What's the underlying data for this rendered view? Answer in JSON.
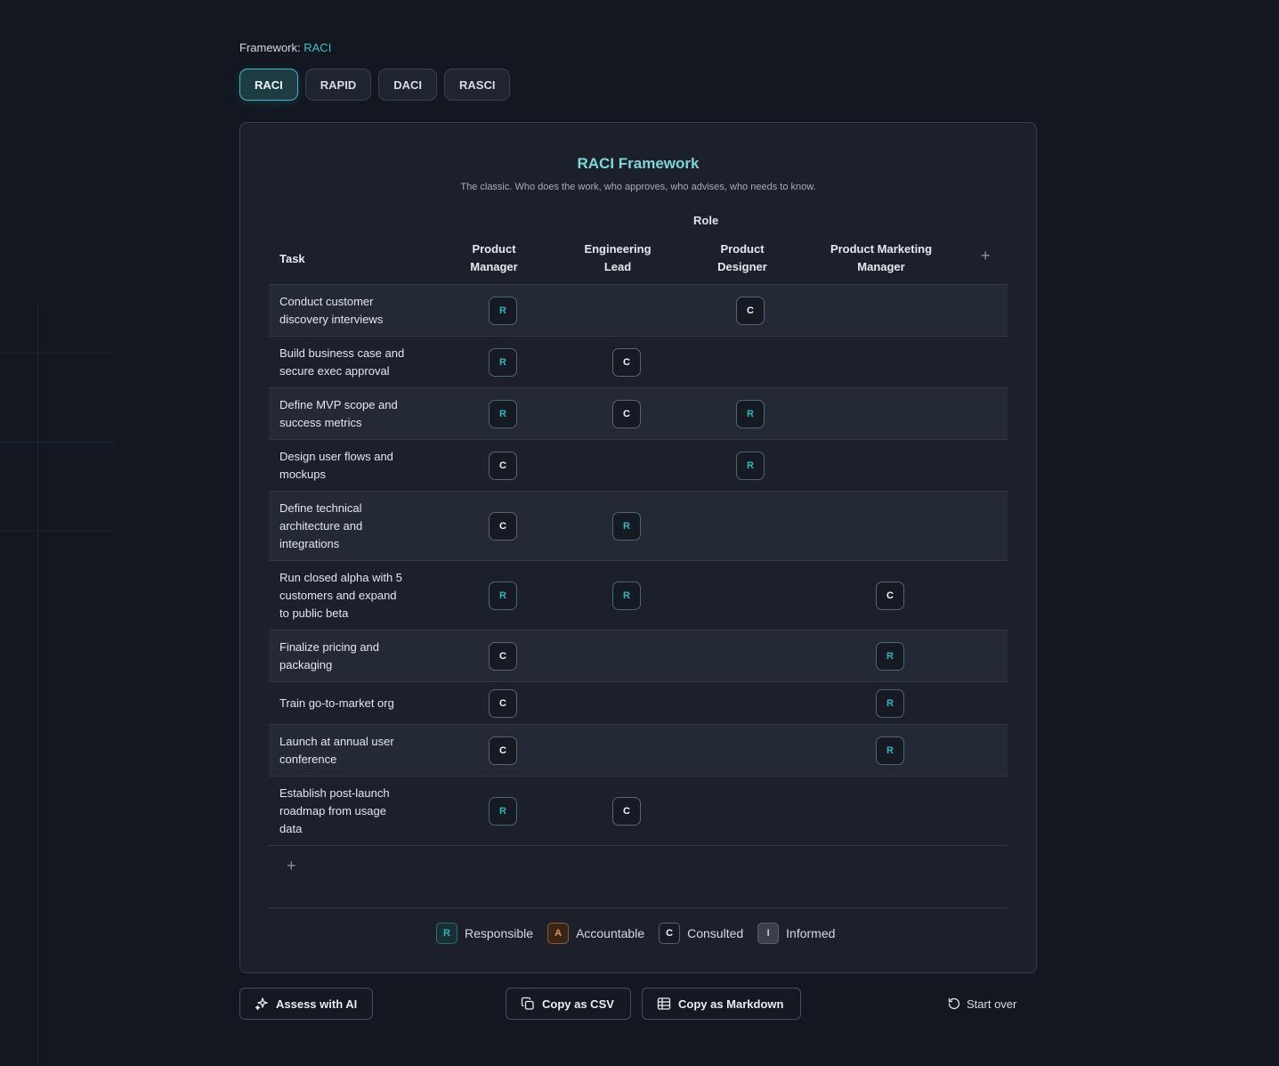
{
  "framework": {
    "label": "Framework:",
    "current": "RACI",
    "tabs": [
      "RACI",
      "RAPID",
      "DACI",
      "RASCI"
    ],
    "active_tab": "RACI"
  },
  "card": {
    "title": "RACI Framework",
    "subtitle": "The classic. Who does the work, who approves, who advises, who needs to know.",
    "role_header": "Role",
    "task_header": "Task",
    "roles": [
      {
        "line1": "Product",
        "line2": "Manager"
      },
      {
        "line1": "Engineering",
        "line2": "Lead"
      },
      {
        "line1": "Product",
        "line2": "Designer"
      },
      {
        "line1": "Product Marketing",
        "line2": "Manager"
      }
    ],
    "add_role_symbol": "+",
    "add_row_symbol": "+"
  },
  "rows": [
    {
      "lines": [
        "Conduct customer",
        "discovery interviews"
      ],
      "cells": [
        "R",
        "",
        "C",
        ""
      ]
    },
    {
      "lines": [
        "Build business case and",
        "secure exec approval"
      ],
      "cells": [
        "R",
        "C",
        "",
        ""
      ]
    },
    {
      "lines": [
        "Define MVP scope and",
        "success metrics"
      ],
      "cells": [
        "R",
        "C",
        "R",
        ""
      ]
    },
    {
      "lines": [
        "Design user flows and",
        "mockups"
      ],
      "cells": [
        "C",
        "",
        "R",
        ""
      ]
    },
    {
      "lines": [
        "Define technical",
        "architecture and",
        "integrations"
      ],
      "cells": [
        "C",
        "R",
        "",
        ""
      ]
    },
    {
      "lines": [
        "Run closed alpha with 5",
        "customers and expand",
        "to public beta"
      ],
      "cells": [
        "R",
        "R",
        "",
        "C"
      ]
    },
    {
      "lines": [
        "Finalize pricing and",
        "packaging"
      ],
      "cells": [
        "C",
        "",
        "",
        "R"
      ]
    },
    {
      "lines": [
        "Train go-to-market org"
      ],
      "cells": [
        "C",
        "",
        "",
        "R"
      ]
    },
    {
      "lines": [
        "Launch at annual user",
        "conference"
      ],
      "cells": [
        "C",
        "",
        "",
        "R"
      ]
    },
    {
      "lines": [
        "Establish post-launch",
        "roadmap from usage",
        "data"
      ],
      "cells": [
        "R",
        "C",
        "",
        ""
      ]
    }
  ],
  "legend": [
    {
      "letter": "R",
      "label": "Responsible"
    },
    {
      "letter": "A",
      "label": "Accountable"
    },
    {
      "letter": "C",
      "label": "Consulted"
    },
    {
      "letter": "I",
      "label": "Informed"
    }
  ],
  "actions": {
    "assess": "Assess with AI",
    "copy_csv": "Copy as CSV",
    "copy_md": "Copy as Markdown",
    "start_over": "Start over"
  },
  "colors": {
    "accent": "#3fc0cc",
    "responsible": "#34b4c1",
    "accountable": "#ef8a52",
    "background": "#121720",
    "card": "#1b202a"
  }
}
